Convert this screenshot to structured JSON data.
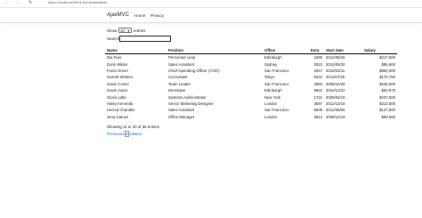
{
  "browser": {
    "url": "https://localhost:5001/home/datatable",
    "back": "←",
    "forward": "→",
    "reload": "↻"
  },
  "navbar": {
    "brand": "AjaxMVC",
    "links": [
      "Home",
      "Privacy"
    ]
  },
  "controls": {
    "show_label": "Show",
    "entries_value": "10",
    "entries_label": "entries",
    "search_label": "Search:"
  },
  "table": {
    "columns": [
      "Name",
      "Position",
      "Office",
      "Extn.",
      "Start date",
      "Salary"
    ],
    "rows": [
      [
        "Dai Rios",
        "Personnel Lead",
        "Edinburgh",
        "2290",
        "2012/09/26",
        "$217,500"
      ],
      [
        "Doris Wilder",
        "Sales Assistant",
        "Sydney",
        "3023",
        "2010/09/20",
        "$85,600"
      ],
      [
        "Fiona Green",
        "Chief Operating Officer (COO)",
        "San Francisco",
        "2947",
        "2010/03/11",
        "$850,000"
      ],
      [
        "Garrett Winters",
        "Accountant",
        "Tokyo",
        "8422",
        "2011/07/25",
        "$170,750"
      ],
      [
        "Gavin Cortez",
        "Team Leader",
        "San Francisco",
        "2860",
        "2008/10/26",
        "$235,500"
      ],
      [
        "Gavin Joyce",
        "Developer",
        "Edinburgh",
        "8822",
        "2010/12/22",
        "$92,575"
      ],
      [
        "Gloria Little",
        "Systems Administrator",
        "New York",
        "1721",
        "2009/04/10",
        "$237,500"
      ],
      [
        "Haley Kennedy",
        "Senior Marketing Designer",
        "London",
        "3597",
        "2012/12/18",
        "$313,500"
      ],
      [
        "Herrod Chandler",
        "Sales Assistant",
        "San Francisco",
        "9608",
        "2012/08/06",
        "$137,500"
      ],
      [
        "Jena Gaines",
        "Office Manager",
        "London",
        "3814",
        "2008/12/19",
        "$90,560"
      ]
    ]
  },
  "info": "Showing 11 to 20 of 36 entries",
  "pagination": {
    "previous": "Previous",
    "pages": [
      "1",
      "2",
      "3",
      "4"
    ],
    "current": "2",
    "next": "Next"
  }
}
